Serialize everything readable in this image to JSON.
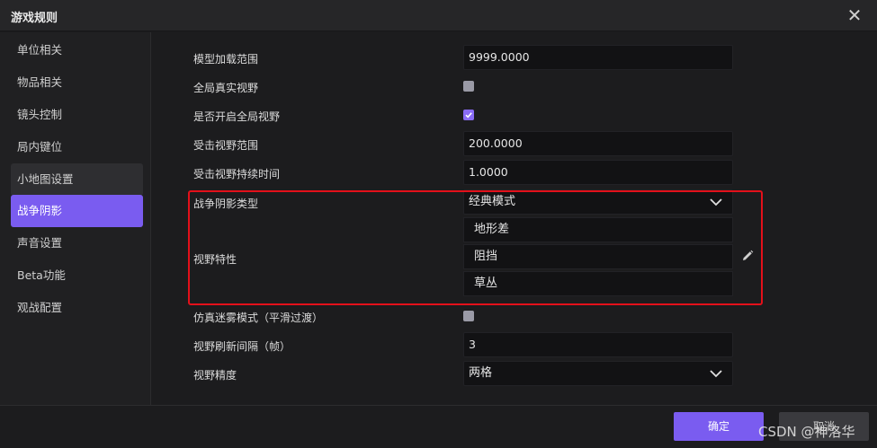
{
  "window": {
    "title": "游戏规则",
    "close_glyph": "✕"
  },
  "sidebar": {
    "items": [
      {
        "label": "单位相关"
      },
      {
        "label": "物品相关"
      },
      {
        "label": "镜头控制"
      },
      {
        "label": "局内键位"
      },
      {
        "label": "小地图设置"
      },
      {
        "label": "战争阴影"
      },
      {
        "label": "声音设置"
      },
      {
        "label": "Beta功能"
      },
      {
        "label": "观战配置"
      }
    ],
    "active_label": "战争阴影"
  },
  "settings": {
    "model_load_range": {
      "label": "模型加载范围",
      "value": "9999.0000"
    },
    "global_true_vision": {
      "label": "全局真实视野",
      "checked": false
    },
    "enable_global_vision": {
      "label": "是否开启全局视野",
      "checked": true
    },
    "hit_vision_range": {
      "label": "受击视野范围",
      "value": "200.0000"
    },
    "hit_vision_duration": {
      "label": "受击视野持续时间",
      "value": "1.0000"
    },
    "fog_type": {
      "label": "战争阴影类型",
      "value": "经典模式"
    },
    "vision_traits": {
      "label": "视野特性",
      "items": [
        "地形差",
        "阻挡",
        "草丛"
      ]
    },
    "simulated_fog": {
      "label": "仿真迷雾模式（平滑过渡）",
      "checked": false
    },
    "vision_refresh": {
      "label": "视野刷新间隔（帧）",
      "value": "3"
    },
    "vision_precision": {
      "label": "视野精度",
      "value": "两格"
    }
  },
  "footer": {
    "ok_label": "确定",
    "cancel_label": "取消"
  },
  "watermark": "CSDN @神洛华",
  "colors": {
    "accent": "#7a5cf0",
    "highlight": "#e3101a",
    "background": "#1c1c1e"
  }
}
